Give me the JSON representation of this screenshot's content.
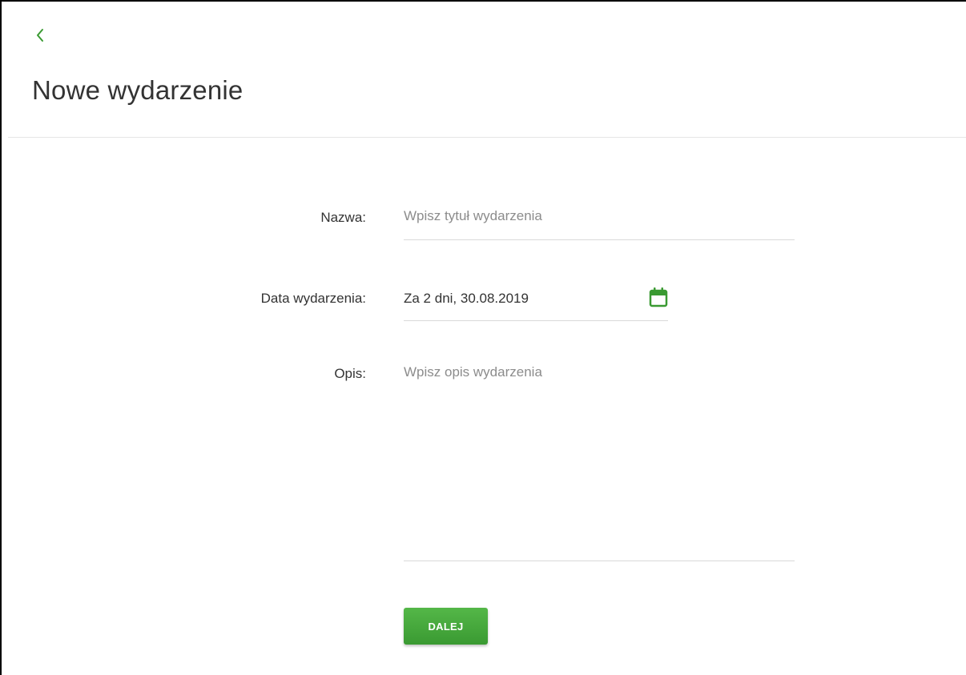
{
  "header": {
    "back_icon": "chevron-left-icon",
    "title": "Nowe wydarzenie"
  },
  "form": {
    "name": {
      "label": "Nazwa:",
      "value": "",
      "placeholder": "Wpisz tytuł wydarzenia"
    },
    "date": {
      "label": "Data wydarzenia:",
      "value": "Za 2 dni, 30.08.2019",
      "icon": "calendar-icon"
    },
    "description": {
      "label": "Opis:",
      "value": "",
      "placeholder": "Wpisz opis wydarzenia"
    },
    "submit_label": "DALEJ"
  },
  "colors": {
    "accent": "#3a9a32",
    "text": "#333333",
    "placeholder": "#8c8c8c",
    "divider": "#e6e6e6"
  }
}
